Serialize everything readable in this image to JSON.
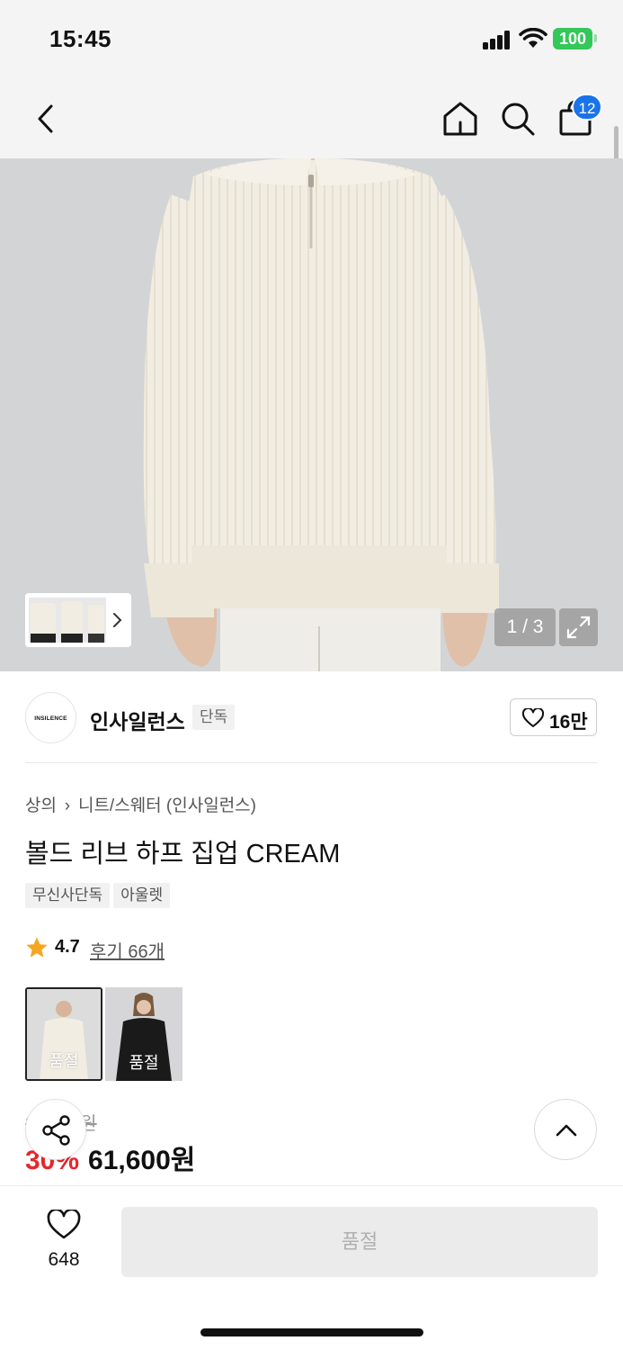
{
  "status_bar": {
    "time": "15:45",
    "battery": "100"
  },
  "nav": {
    "cart_count": "12"
  },
  "gallery": {
    "page_counter": "1 / 3"
  },
  "brand": {
    "logo_text": "INSILENCE",
    "name": "인사일런스",
    "tag": "단독",
    "likes": "16만"
  },
  "product": {
    "breadcrumb": {
      "category": "상의",
      "subcategory": "니트/스웨터 (인사일런스)"
    },
    "title": "볼드 리브 하프 집업 CREAM",
    "tags": [
      "무신사단독",
      "아울렛"
    ],
    "rating": "4.7",
    "reviews": "후기 66개",
    "options": [
      {
        "label": "품절"
      },
      {
        "label": "품절"
      }
    ],
    "original_price": "88,000원",
    "discount": "30%",
    "price": "61,600원"
  },
  "bottom_bar": {
    "wish_count": "648",
    "buy_label": "품절"
  },
  "colors": {
    "discount": "#e8262b",
    "badge": "#1a73e8",
    "battery": "#34c759",
    "sweater": "#f2ede2"
  }
}
